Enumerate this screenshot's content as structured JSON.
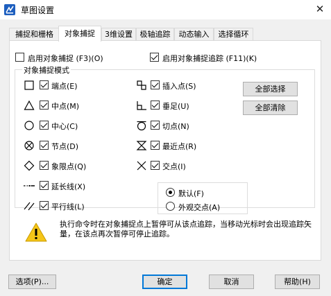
{
  "window": {
    "title": "草图设置",
    "close_glyph": "✕"
  },
  "tabs": [
    {
      "label": "捕捉和栅格"
    },
    {
      "label": "对象捕捉"
    },
    {
      "label": "3维设置"
    },
    {
      "label": "极轴追踪"
    },
    {
      "label": "动态输入"
    },
    {
      "label": "选择循环"
    }
  ],
  "top_options": {
    "enable_osnap": {
      "label": "启用对象捕捉 (F3)(O)",
      "checked": false
    },
    "enable_tracking": {
      "label": "启用对象捕捉追踪 (F11)(K)",
      "checked": true
    }
  },
  "group_title": "对象捕捉模式",
  "left_modes": [
    {
      "label": "端点(E)",
      "checked": true,
      "icon": "square-icon"
    },
    {
      "label": "中点(M)",
      "checked": true,
      "icon": "triangle-icon"
    },
    {
      "label": "中心(C)",
      "checked": true,
      "icon": "circle-icon"
    },
    {
      "label": "节点(D)",
      "checked": true,
      "icon": "node-icon"
    },
    {
      "label": "象限点(Q)",
      "checked": true,
      "icon": "diamond-icon"
    },
    {
      "label": "延长线(X)",
      "checked": true,
      "icon": "extension-icon"
    },
    {
      "label": "平行线(L)",
      "checked": true,
      "icon": "parallel-icon"
    }
  ],
  "right_modes": [
    {
      "label": "插入点(S)",
      "checked": true,
      "icon": "insert-icon"
    },
    {
      "label": "垂足(U)",
      "checked": true,
      "icon": "perpendicular-icon"
    },
    {
      "label": "切点(N)",
      "checked": true,
      "icon": "tangent-icon"
    },
    {
      "label": "最近点(R)",
      "checked": true,
      "icon": "nearest-icon"
    },
    {
      "label": "交点(I)",
      "checked": true,
      "icon": "intersection-icon"
    }
  ],
  "buttons": {
    "select_all": "全部选择",
    "clear_all": "全部清除",
    "options": "选项(P)...",
    "ok": "确定",
    "cancel": "取消",
    "help": "帮助(H)"
  },
  "radio": {
    "default": {
      "label": "默认(F)",
      "selected": true
    },
    "apparent": {
      "label": "外观交点(A)",
      "selected": false
    }
  },
  "warning_text": "执行命令时在对象捕捉点上暂停可从该点追踪，当移动光标时会出现追踪矢量，在该点再次暂停可停止追踪。",
  "colors": {
    "accent": "#0078d7",
    "warning": "#f5c518"
  }
}
